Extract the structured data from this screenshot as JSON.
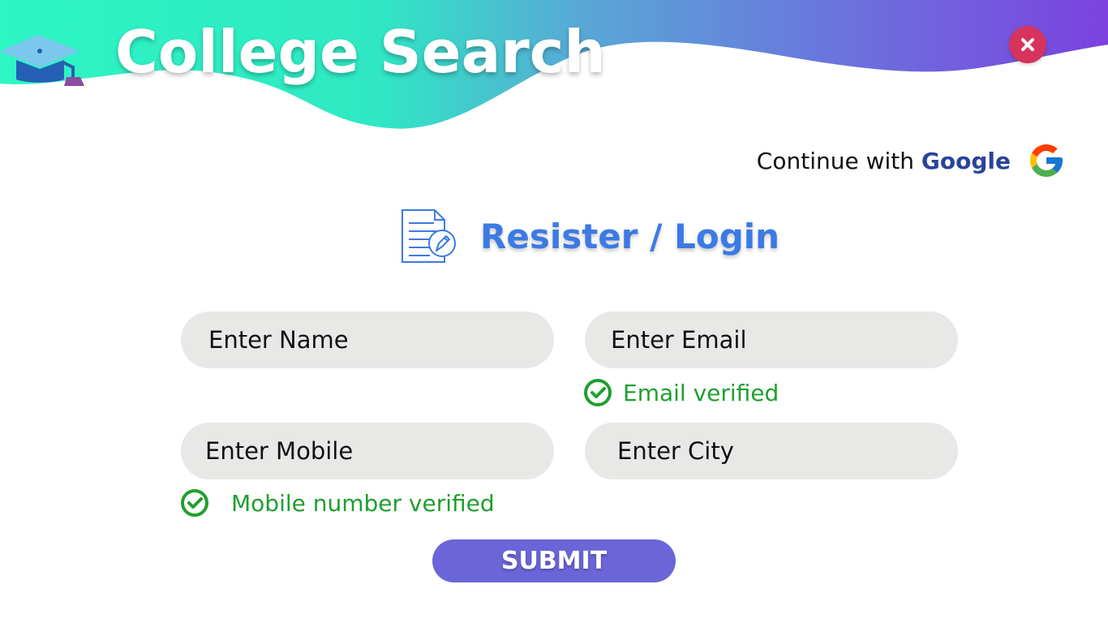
{
  "header": {
    "title": "College Search",
    "logo_icon": "graduation-cap-icon",
    "close_icon": "close-icon"
  },
  "auth": {
    "google_prefix": "Continue with",
    "google_brand": "Google",
    "google_icon": "google-g-icon"
  },
  "form": {
    "title": "Resister / Login",
    "title_icon": "document-edit-icon",
    "fields": {
      "name_placeholder": "Enter Name",
      "email_placeholder": "Enter Email",
      "mobile_placeholder": "Enter Mobile",
      "city_placeholder": "Enter City"
    },
    "status": {
      "email_verified": "Email verified",
      "mobile_verified": "Mobile number verified",
      "check_icon": "check-circle-icon"
    },
    "submit_label": "SUBMIT"
  },
  "colors": {
    "header_gradient_start": "#2df5c3",
    "header_gradient_end": "#7c42df",
    "title_blue": "#3c7ae4",
    "field_bg": "#e8e8e7",
    "success_green": "#1f9f2e",
    "submit_purple": "#6b65d8",
    "close_red": "#d6335d",
    "google_blue": "#29449b"
  }
}
